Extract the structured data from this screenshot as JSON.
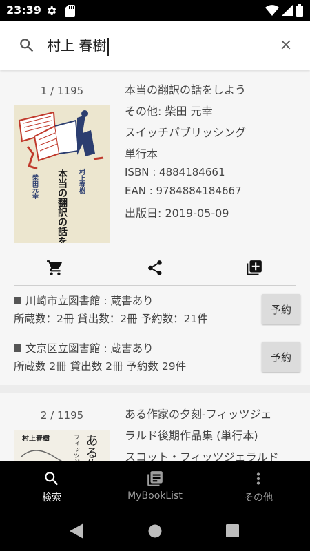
{
  "status_bar": {
    "time": "23:39"
  },
  "search": {
    "query": "村上 春樹"
  },
  "results": [
    {
      "counter": "1 / 1195",
      "title": "本当の翻訳の話をしよう",
      "author": "その他: 柴田 元幸",
      "publisher": "スイッチパブリッシング",
      "format": "単行本",
      "isbn": "ISBN : 4884184661",
      "ean": "EAN : 9784884184667",
      "pubdate": "出版日: 2019-05-09",
      "cover_text": {
        "title": "本当の翻訳の話をしよう",
        "author1": "村上春樹",
        "author2": "柴田元幸"
      },
      "libraries": [
        {
          "name": "川崎市立図書館 : 蔵書あり",
          "stats": "所蔵数：2冊 貸出数：2冊 予約数：21件",
          "button": "予約"
        },
        {
          "name": "文京区立図書館 : 蔵書あり",
          "stats": "所蔵数 2冊 貸出数 2冊 予約数 29件",
          "button": "予約"
        }
      ]
    },
    {
      "counter": "2 / 1195",
      "title": "ある作家の夕刻-フィッツジェ",
      "title2": "ラルド後期作品集 (単行本)",
      "author": "スコット・フィッツジェラルド",
      "cover_text": {
        "title": "ある作",
        "author1": "村上春樹",
        "sub": "フィッツジ"
      }
    }
  ],
  "bottom_nav": [
    {
      "label": "検索",
      "icon": "search-icon",
      "active": true
    },
    {
      "label": "MyBookList",
      "icon": "book-list-icon",
      "active": false
    },
    {
      "label": "その他",
      "icon": "more-vert-icon",
      "active": false
    }
  ],
  "colors": {
    "accent": "#000000",
    "card": "#f6f6f6",
    "background": "#ececec",
    "button": "#dcdcdc"
  }
}
